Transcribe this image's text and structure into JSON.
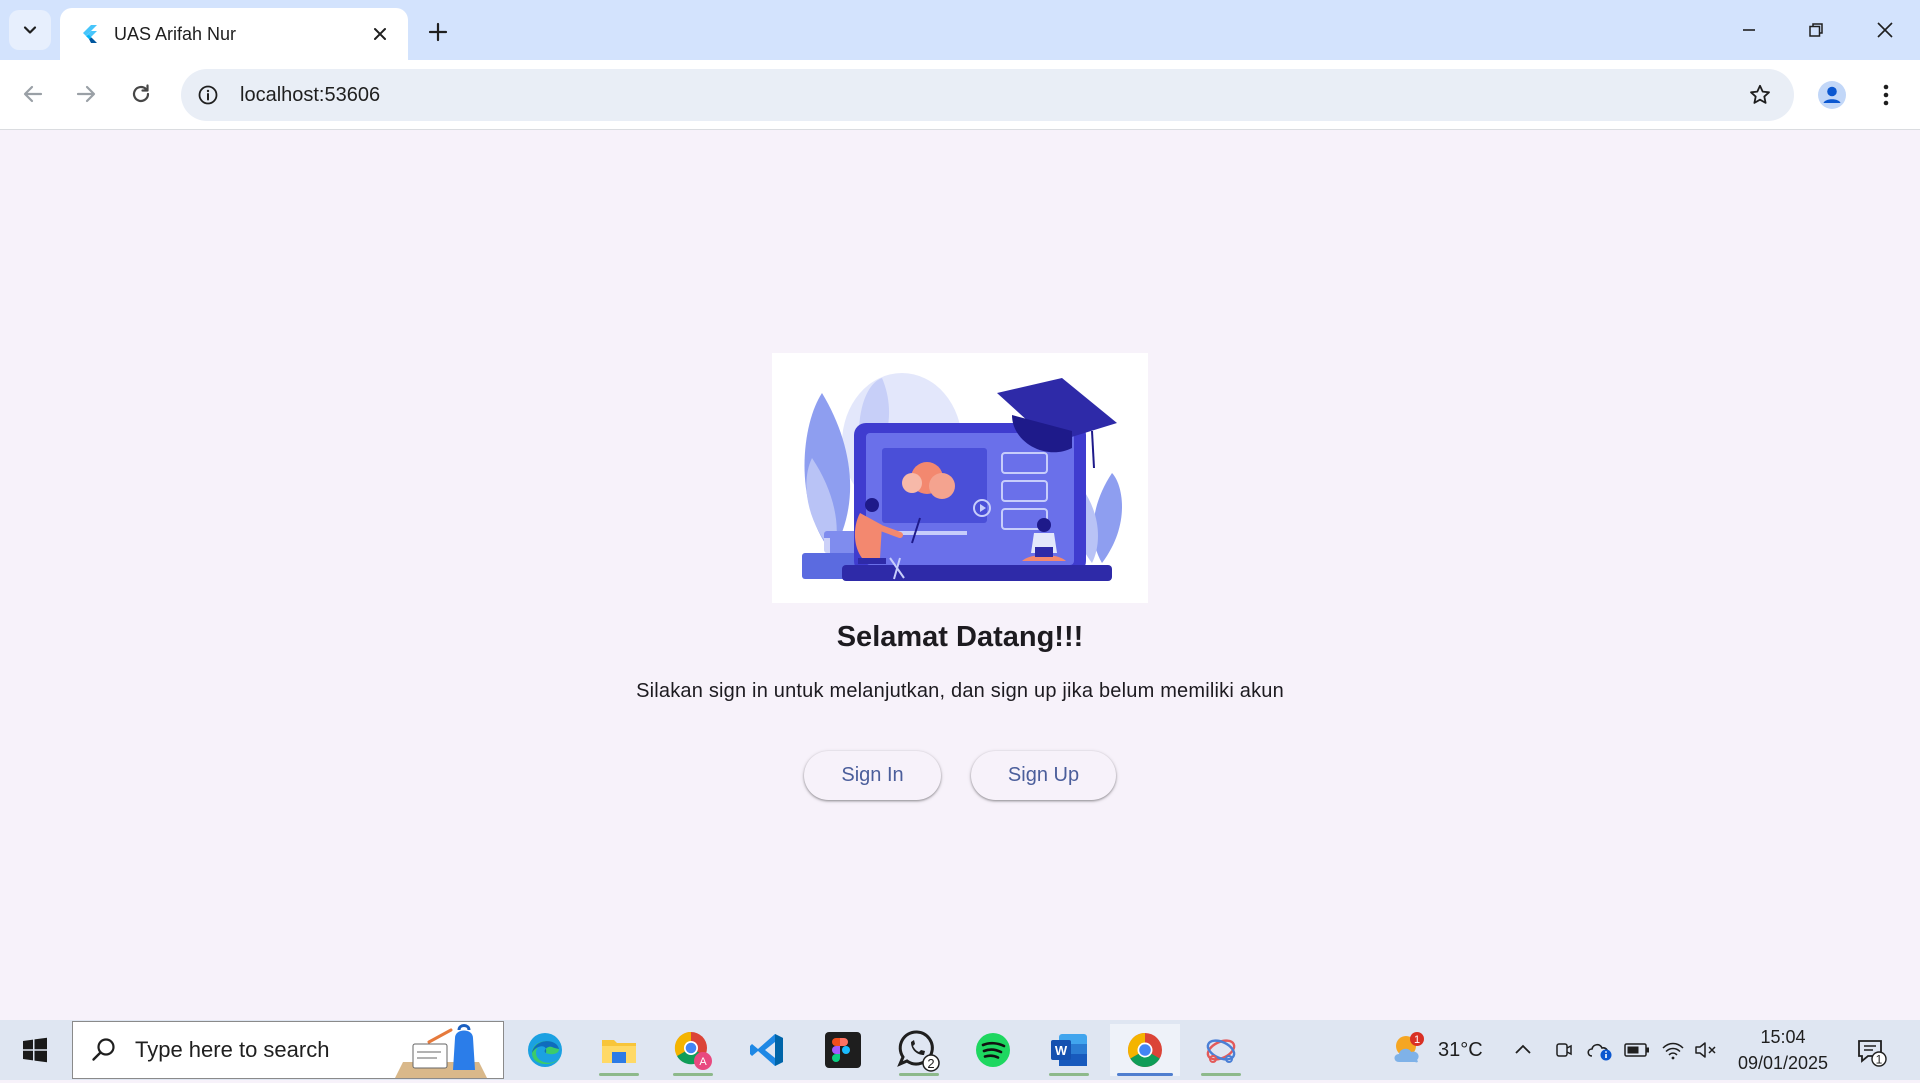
{
  "browser": {
    "tab_title": "UAS Arifah Nur",
    "url": "localhost:53606"
  },
  "page": {
    "title": "Selamat Datang!!!",
    "subtitle": "Silakan sign in untuk melanjutkan, dan sign up jika belum memiliki akun",
    "signin_label": "Sign In",
    "signup_label": "Sign Up",
    "accent_color": "#4b5e9b",
    "background_color": "#f7f2fa"
  },
  "taskbar": {
    "search_placeholder": "Type here to search",
    "apps": [
      {
        "name": "Microsoft Edge",
        "icon": "edge-icon"
      },
      {
        "name": "File Explorer",
        "icon": "folder-icon"
      },
      {
        "name": "Google Chrome Profile",
        "icon": "chrome-profile-icon",
        "badge": "A"
      },
      {
        "name": "Visual Studio Code",
        "icon": "vscode-icon"
      },
      {
        "name": "Figma",
        "icon": "figma-icon"
      },
      {
        "name": "WhatsApp",
        "icon": "whatsapp-icon",
        "badge": "2"
      },
      {
        "name": "Spotify",
        "icon": "spotify-icon"
      },
      {
        "name": "Microsoft Word",
        "icon": "word-icon"
      },
      {
        "name": "Google Chrome",
        "icon": "chrome-icon",
        "active": true
      },
      {
        "name": "Snipping Tool",
        "icon": "snip-icon"
      }
    ],
    "weather_temp": "31°C",
    "weather_badge": "1",
    "time": "15:04",
    "date": "09/01/2025",
    "notification_count": "1"
  }
}
